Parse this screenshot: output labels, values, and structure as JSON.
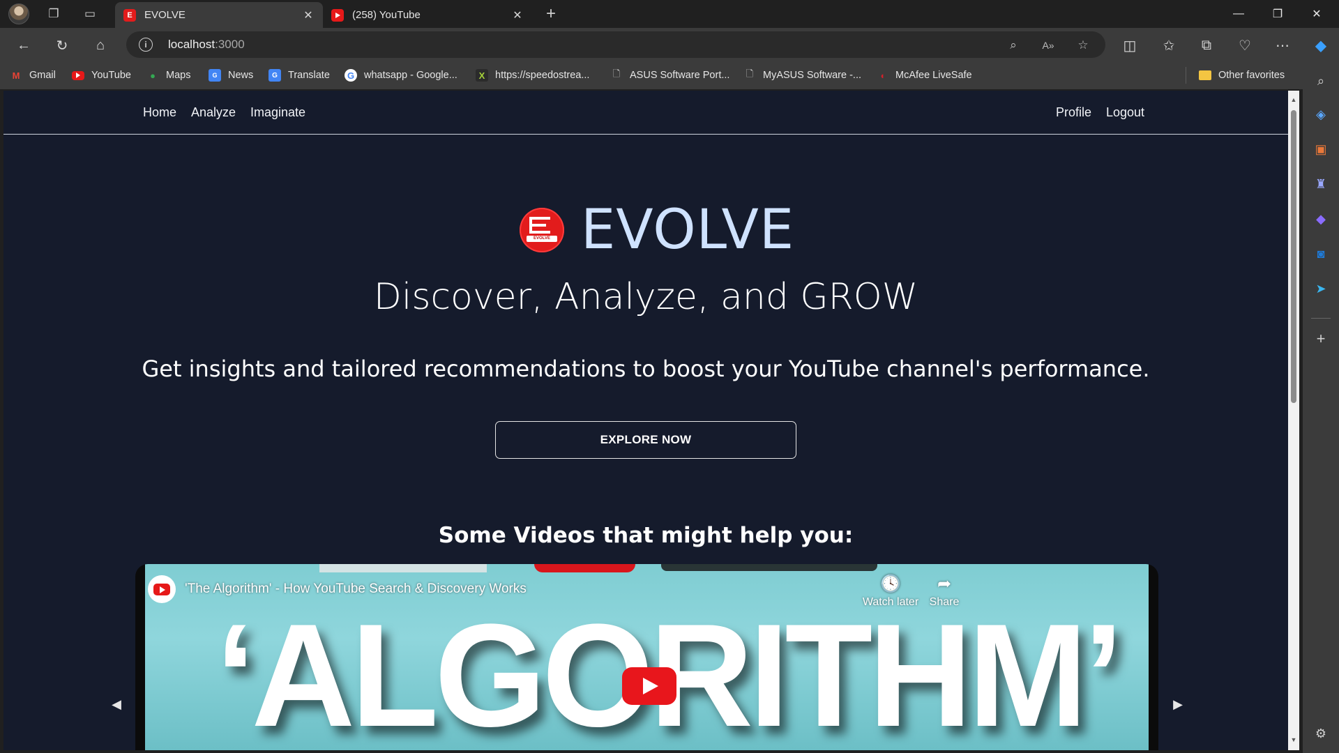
{
  "browser": {
    "tabs": [
      {
        "title": "EVOLVE",
        "active": true
      },
      {
        "title": "(258) YouTube",
        "active": false
      }
    ],
    "new_tab_symbol": "+",
    "address": {
      "host": "localhost",
      "port": ":3000"
    },
    "favorites": [
      {
        "label": "Gmail",
        "icon": "gmail-icon"
      },
      {
        "label": "YouTube",
        "icon": "youtube-icon"
      },
      {
        "label": "Maps",
        "icon": "maps-icon"
      },
      {
        "label": "News",
        "icon": "news-icon"
      },
      {
        "label": "Translate",
        "icon": "translate-icon"
      },
      {
        "label": "whatsapp - Google...",
        "icon": "google-icon"
      },
      {
        "label": "https://speedostrea...",
        "icon": "x-icon"
      },
      {
        "label": "ASUS Software Port...",
        "icon": "page-icon"
      },
      {
        "label": "MyASUS Software -...",
        "icon": "page-icon"
      },
      {
        "label": "McAfee LiveSafe",
        "icon": "mcafee-icon"
      }
    ],
    "other_favorites": "Other favorites",
    "accent": "#2f6fd6"
  },
  "site": {
    "nav_left": [
      "Home",
      "Analyze",
      "Imaginate"
    ],
    "nav_right": [
      "Profile",
      "Logout"
    ],
    "brand": "EVOLVE",
    "logo_text": "EVOLVE",
    "headline": "Discover, Analyze, and GROW",
    "subline": "Get insights and tailored recommendations to boost your YouTube channel's performance.",
    "cta": "EXPLORE NOW",
    "section_title": "Some Videos that might help you:",
    "video": {
      "title": "'The Algorithm' - How YouTube Search & Discovery Works",
      "thumbnail_text": "‘ALGORITHM’",
      "watch_later": "Watch later",
      "share": "Share"
    },
    "colors": {
      "background": "#151b2c",
      "brand": "#cfe2ff",
      "logo_red": "#e21c1c",
      "play_red": "#e8161c"
    }
  }
}
